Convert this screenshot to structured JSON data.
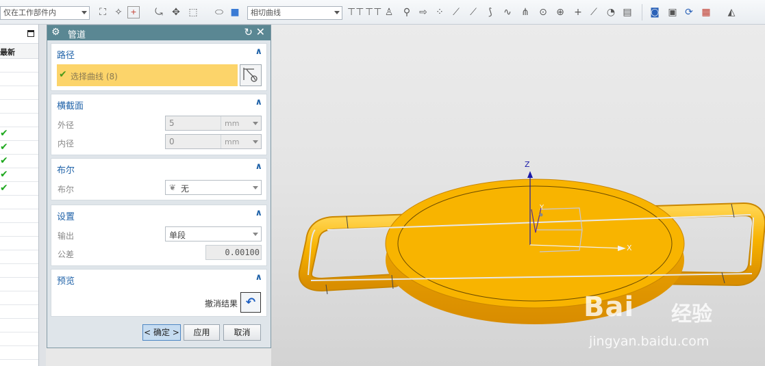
{
  "toolbar": {
    "selection_filter": "仅在工作部件内",
    "curve_rule": "相切曲线",
    "icons": [
      "snap-icon",
      "filter-icon",
      "select-box-icon",
      "rotate-icon",
      "pan-icon",
      "rect-select-icon",
      "view-icon",
      "cube-icon",
      "ruler-icon",
      "point-icon",
      "vector-icon",
      "arrow-icon",
      "grid-icon",
      "line-icon",
      "arc-icon",
      "spline-icon",
      "star-icon",
      "circle-icon",
      "target-icon",
      "plus-icon",
      "slash-icon",
      "shape-icon",
      "book-icon",
      "zoom-icon",
      "window-icon",
      "refresh-icon",
      "layer-icon",
      "display-icon"
    ]
  },
  "navigator": {
    "column_header": "最新",
    "checked_rows": [
      6,
      7,
      8,
      9,
      10
    ]
  },
  "dialog": {
    "title": "管道",
    "path": {
      "header": "路径",
      "select_curve": "选择曲线 (8)"
    },
    "cross_section": {
      "header": "横截面",
      "outer_label": "外径",
      "outer_value": "5",
      "outer_unit": "mm",
      "inner_label": "内径",
      "inner_value": "0",
      "inner_unit": "mm"
    },
    "boolean": {
      "header": "布尔",
      "label": "布尔",
      "value": "无"
    },
    "settings": {
      "header": "设置",
      "output_label": "输出",
      "output_value": "单段",
      "tolerance_label": "公差",
      "tolerance_value": "0.00100"
    },
    "preview": {
      "header": "预览",
      "undo_label": "撤消结果"
    },
    "buttons": {
      "ok": "< 确定 >",
      "apply": "应用",
      "cancel": "取消"
    }
  },
  "viewport": {
    "axis_z": "Z",
    "axis_x": "X",
    "axis_y": "Y",
    "part_color": "#f8b400",
    "watermark_brand": "Bai",
    "watermark_brand2": "经验",
    "watermark_url": "jingyan.baidu.com"
  }
}
